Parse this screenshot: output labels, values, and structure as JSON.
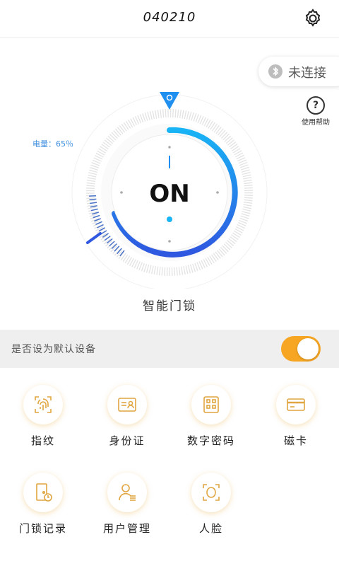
{
  "header": {
    "title": "040210"
  },
  "bluetooth": {
    "status_label": "未连接"
  },
  "help": {
    "label": "使用帮助",
    "glyph": "?"
  },
  "battery": {
    "label": "电量：65％",
    "level_percent": 65
  },
  "lock": {
    "state_text": "ON",
    "name": "智能门锁"
  },
  "settings": {
    "default_device_label": "是否设为默认设备",
    "default_device_on": true
  },
  "features": [
    {
      "label": "指纹",
      "icon": "fingerprint-icon"
    },
    {
      "label": "身份证",
      "icon": "id-card-icon"
    },
    {
      "label": "数字密码",
      "icon": "keypad-icon"
    },
    {
      "label": "磁卡",
      "icon": "magnetic-card-icon"
    },
    {
      "label": "门锁记录",
      "icon": "door-record-icon"
    },
    {
      "label": "用户管理",
      "icon": "user-management-icon"
    },
    {
      "label": "人脸",
      "icon": "face-icon"
    }
  ],
  "colors": {
    "accent_blue": "#1f8ff0",
    "accent_dark_blue": "#2f57e0",
    "toggle_orange": "#f6a623",
    "icon_gold": "#e0a640"
  }
}
